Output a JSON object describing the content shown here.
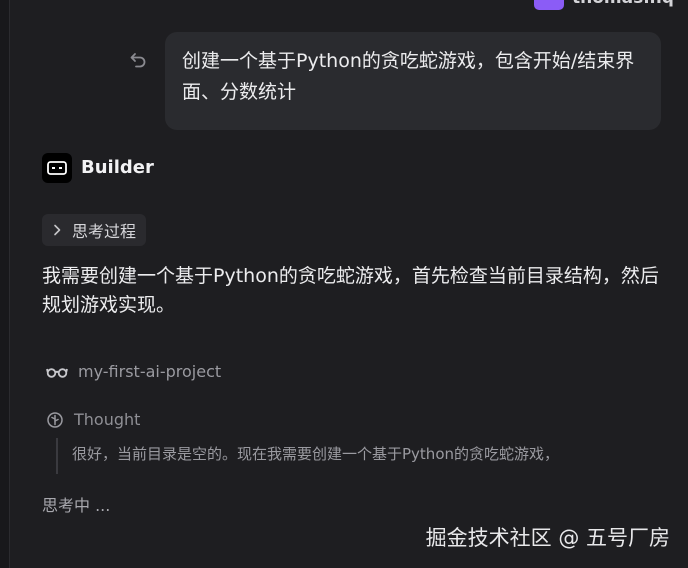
{
  "user": {
    "name": "thomas.hq"
  },
  "user_message": {
    "text": "创建一个基于Python的贪吃蛇游戏，包含开始/结束界面、分数统计"
  },
  "assistant": {
    "name": "Builder",
    "thinking_toggle_label": "思考过程",
    "reply": "我需要创建一个基于Python的贪吃蛇游戏，首先检查当前目录结构，然后规划游戏实现。",
    "project_name": "my-first-ai-project",
    "thought_label": "Thought",
    "thought_text": "很好，当前目录是空的。现在我需要创建一个基于Python的贪吃蛇游戏，",
    "status": "思考中 ..."
  },
  "watermark": "掘金技术社区 @ 五号厂房",
  "icons": [
    "undo-icon",
    "builder-logo-icon",
    "chevron-right-icon",
    "glasses-icon",
    "thought-icon"
  ],
  "colors": {
    "background": "#1e1e21",
    "bubble": "#2a2b2f",
    "avatar": "#8b5cf6"
  }
}
